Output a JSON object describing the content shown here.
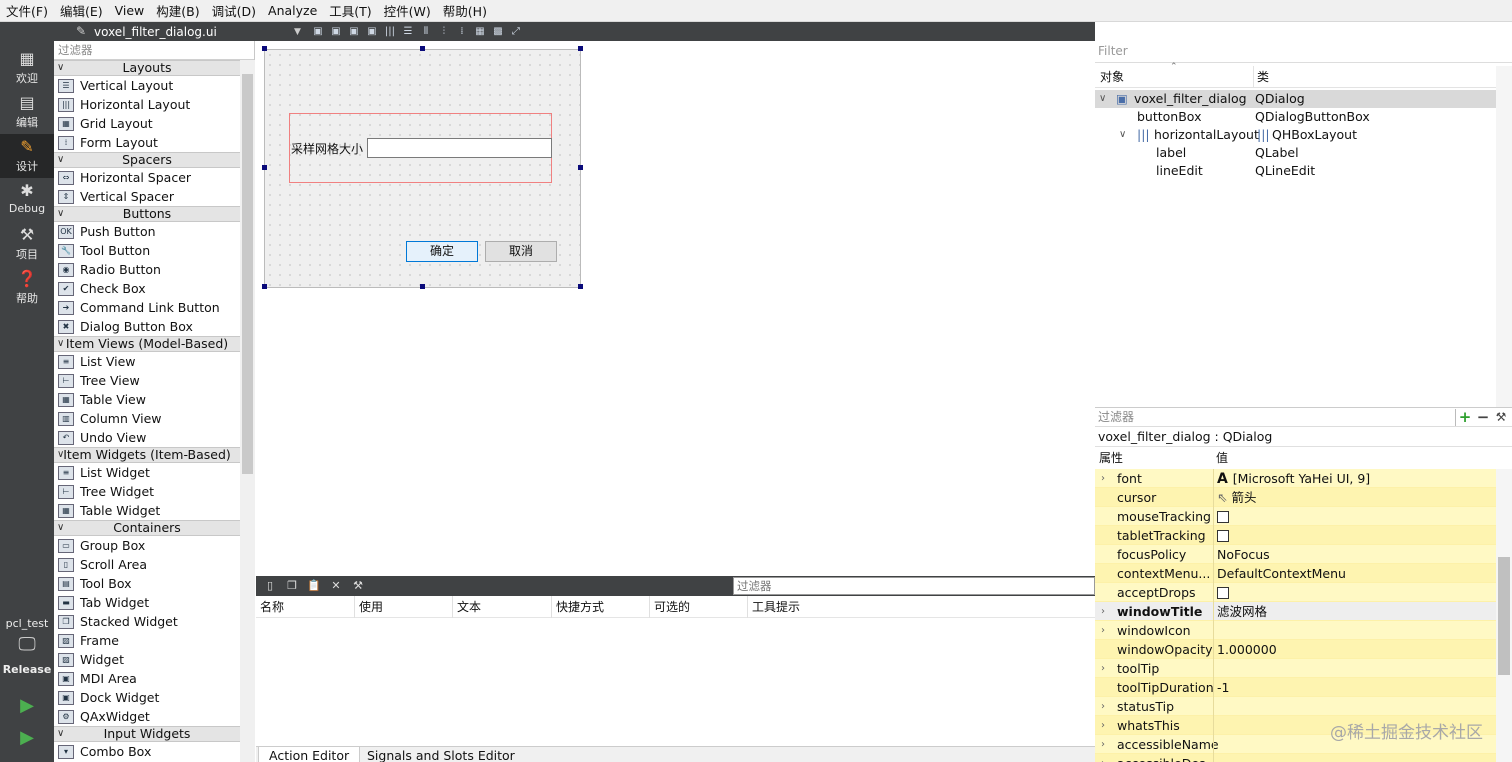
{
  "menubar": [
    "文件(F)",
    "编辑(E)",
    "View",
    "构建(B)",
    "调试(D)",
    "Analyze",
    "工具(T)",
    "控件(W)",
    "帮助(H)"
  ],
  "modes": [
    {
      "label": "欢迎",
      "icon": "grid-icon"
    },
    {
      "label": "编辑",
      "icon": "edit-doc-icon"
    },
    {
      "label": "设计",
      "icon": "pencil-icon"
    },
    {
      "label": "Debug",
      "icon": "bug-icon"
    },
    {
      "label": "项目",
      "icon": "wrench-icon"
    },
    {
      "label": "帮助",
      "icon": "help-icon"
    }
  ],
  "kit": {
    "project": "pcl_test",
    "build": "Release"
  },
  "form_toolbar": {
    "file": "voxel_filter_dialog.ui"
  },
  "widget_box": {
    "filter": "过滤器",
    "groups": [
      {
        "title": "Layouts",
        "items": [
          "Vertical Layout",
          "Horizontal Layout",
          "Grid Layout",
          "Form Layout"
        ]
      },
      {
        "title": "Spacers",
        "items": [
          "Horizontal Spacer",
          "Vertical Spacer"
        ]
      },
      {
        "title": "Buttons",
        "items": [
          "Push Button",
          "Tool Button",
          "Radio Button",
          "Check Box",
          "Command Link Button",
          "Dialog Button Box"
        ]
      },
      {
        "title": "Item Views (Model-Based)",
        "items": [
          "List View",
          "Tree View",
          "Table View",
          "Column View",
          "Undo View"
        ]
      },
      {
        "title": "Item Widgets (Item-Based)",
        "items": [
          "List Widget",
          "Tree Widget",
          "Table Widget"
        ]
      },
      {
        "title": "Containers",
        "items": [
          "Group Box",
          "Scroll Area",
          "Tool Box",
          "Tab Widget",
          "Stacked Widget",
          "Frame",
          "Widget",
          "MDI Area",
          "Dock Widget",
          "QAxWidget"
        ]
      },
      {
        "title": "Input Widgets",
        "items": [
          "Combo Box"
        ]
      }
    ]
  },
  "form": {
    "label": "采样网格大小",
    "ok": "确定",
    "cancel": "取消"
  },
  "action_editor": {
    "filter": "过滤器",
    "columns": [
      "名称",
      "使用",
      "文本",
      "快捷方式",
      "可选的",
      "工具提示"
    ],
    "tabs": [
      "Action Editor",
      "Signals and Slots Editor"
    ]
  },
  "object_inspector": {
    "filter": "Filter",
    "col_object": "对象",
    "col_class": "类",
    "rows": [
      {
        "name": "voxel_filter_dialog",
        "cls": "QDialog"
      },
      {
        "name": "buttonBox",
        "cls": "QDialogButtonBox"
      },
      {
        "name": "horizontalLayout",
        "cls": "QHBoxLayout"
      },
      {
        "name": "label",
        "cls": "QLabel"
      },
      {
        "name": "lineEdit",
        "cls": "QLineEdit"
      }
    ]
  },
  "property_editor": {
    "filter": "过滤器",
    "object": "voxel_filter_dialog : QDialog",
    "col_prop": "属性",
    "col_value": "值",
    "rows": [
      {
        "name": "font",
        "value": "[Microsoft YaHei UI, 9]"
      },
      {
        "name": "cursor",
        "value": "箭头"
      },
      {
        "name": "mouseTracking",
        "value": ""
      },
      {
        "name": "tabletTracking",
        "value": ""
      },
      {
        "name": "focusPolicy",
        "value": "NoFocus"
      },
      {
        "name": "contextMenu...",
        "value": "DefaultContextMenu"
      },
      {
        "name": "acceptDrops",
        "value": ""
      },
      {
        "name": "windowTitle",
        "value": "滤波网格"
      },
      {
        "name": "windowIcon",
        "value": ""
      },
      {
        "name": "windowOpacity",
        "value": "1.000000"
      },
      {
        "name": "toolTip",
        "value": ""
      },
      {
        "name": "toolTipDuration",
        "value": "-1"
      },
      {
        "name": "statusTip",
        "value": ""
      },
      {
        "name": "whatsThis",
        "value": ""
      },
      {
        "name": "accessibleName",
        "value": ""
      },
      {
        "name": "accessibleDes...",
        "value": ""
      }
    ]
  },
  "watermark": "@稀土掘金技术社区"
}
